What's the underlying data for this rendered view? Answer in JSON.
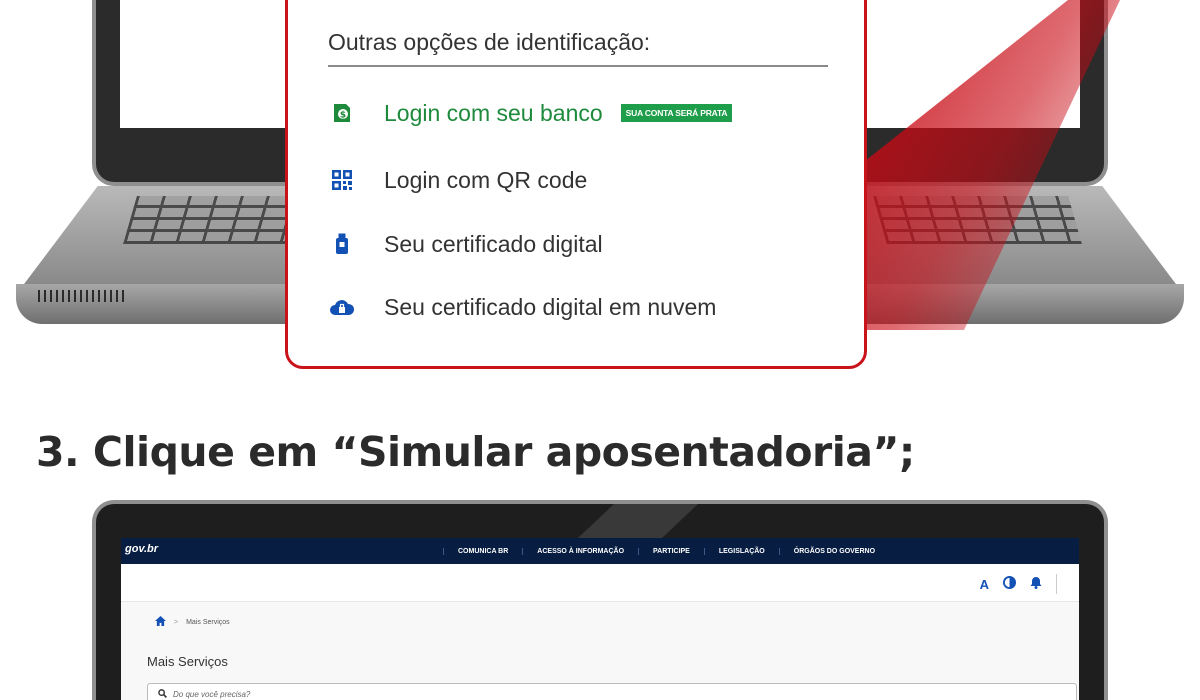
{
  "login_card": {
    "title": "Outras opções de identificação:",
    "options": [
      {
        "label": "Login com seu banco",
        "icon": "bank-login-icon",
        "badge": "SUA CONTA SERÁ PRATA"
      },
      {
        "label": "Login com QR code",
        "icon": "qr-code-icon"
      },
      {
        "label": "Seu certificado digital",
        "icon": "usb-token-icon"
      },
      {
        "label": "Seu certificado digital em nuvem",
        "icon": "cloud-certificate-icon"
      }
    ]
  },
  "step": {
    "title": "3. Clique em “Simular aposentadoria”;"
  },
  "govbr": {
    "logo": "gov.br",
    "nav": [
      "COMUNICA BR",
      "ACESSO À INFORMAÇÃO",
      "PARTICIPE",
      "LEGISLAÇÃO",
      "ÓRGÃOS DO GOVERNO"
    ],
    "header_icons": {
      "font_size": "A",
      "contrast": "contrast-icon",
      "notifications": "bell-icon"
    },
    "breadcrumb": {
      "home_icon": "home-icon",
      "current": "Mais Serviços"
    },
    "page_title": "Mais Serviços",
    "search": {
      "placeholder": "Do que você precisa?"
    }
  },
  "colors": {
    "accent_red": "#c8131b",
    "bank_green": "#1e8a3c",
    "gov_navy": "#071d41",
    "gov_blue": "#1351b4"
  }
}
